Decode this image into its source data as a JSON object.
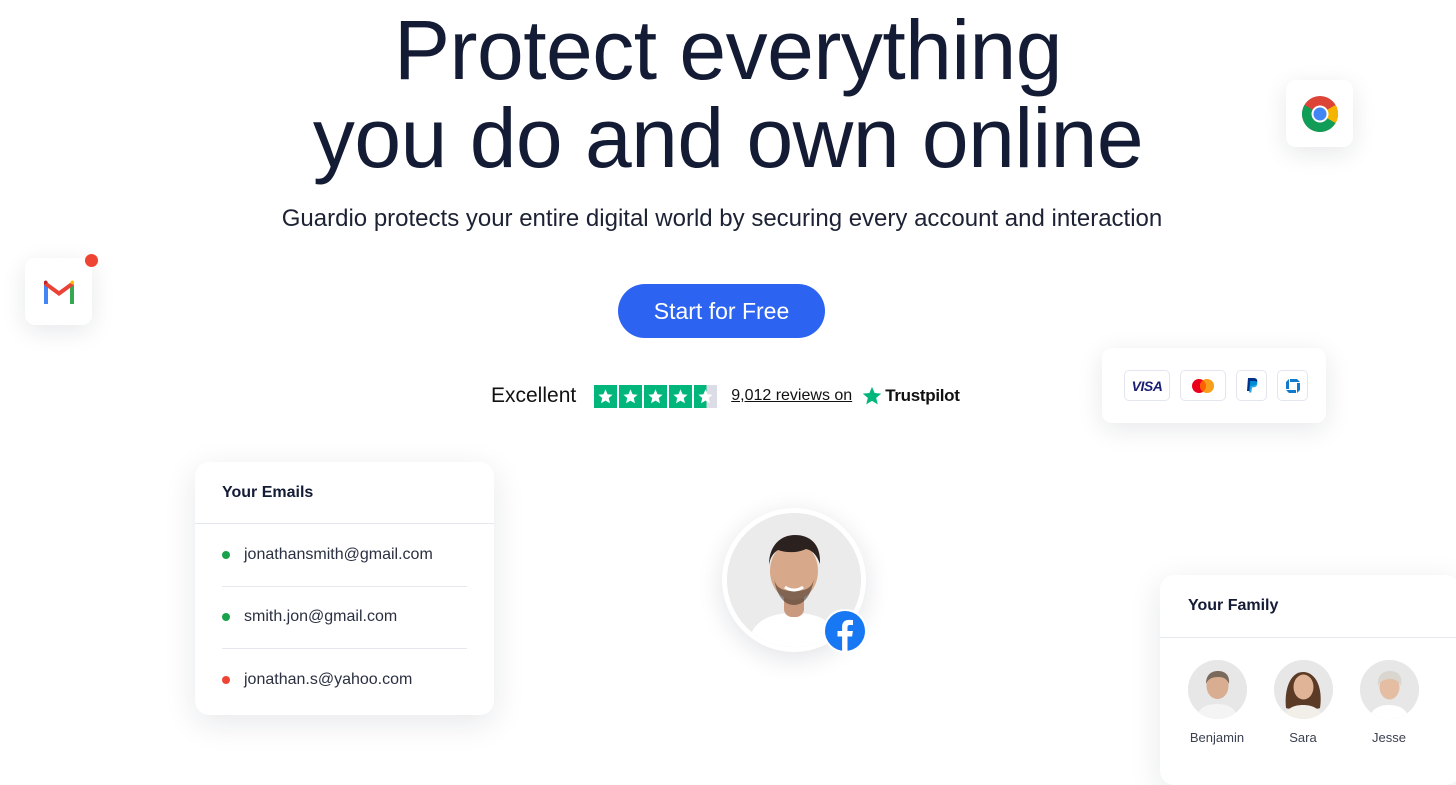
{
  "hero": {
    "title_line1": "Protect everything",
    "title_line2": "you do and own online",
    "subtitle": "Guardio protects your entire digital world by securing every account and interaction"
  },
  "cta": {
    "label": "Start for Free",
    "color": "#2d63f1"
  },
  "rating": {
    "label": "Excellent",
    "stars": 4.5,
    "reviews": "9,012 reviews on",
    "brand": "Trustpilot",
    "star_color": "#00b67a"
  },
  "floating_icons": [
    "gmail-icon",
    "chrome-icon"
  ],
  "payments": [
    "VISA",
    "mastercard-icon",
    "paypal-icon",
    "chase-icon"
  ],
  "emails_card": {
    "title": "Your Emails",
    "items": [
      {
        "address": "jonathansmith@gmail.com",
        "status": "safe",
        "color": "#19a24b"
      },
      {
        "address": "smith.jon@gmail.com",
        "status": "safe",
        "color": "#19a24b"
      },
      {
        "address": "jonathan.s@yahoo.com",
        "status": "alert",
        "color": "#ef4433"
      }
    ]
  },
  "profile": {
    "badge": "facebook-icon"
  },
  "family_card": {
    "title": "Your Family",
    "members": [
      "Benjamin",
      "Sara",
      "Jesse"
    ]
  }
}
